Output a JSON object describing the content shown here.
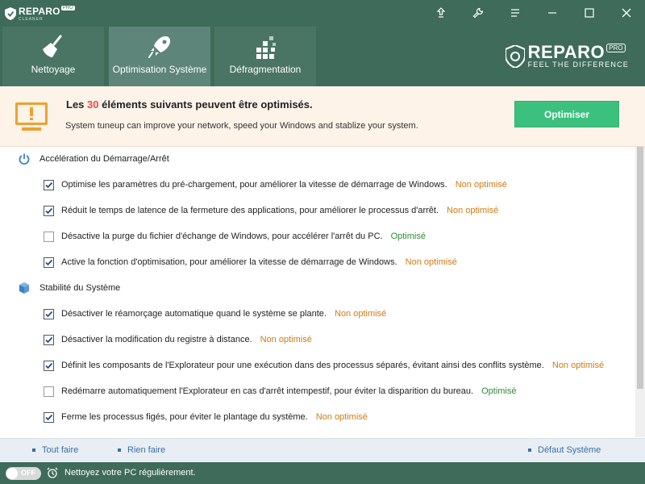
{
  "app": {
    "logo_name": "REPARO",
    "logo_sub": "CLEANER",
    "logo_badge": "PRO"
  },
  "window_controls": [
    "upload-icon",
    "wrench-icon",
    "menu-icon",
    "minimize-icon",
    "maximize-icon",
    "close-icon"
  ],
  "tabs": [
    {
      "label": "Nettoyage",
      "icon": "broom-icon",
      "active": false
    },
    {
      "label": "Optimisation Système",
      "icon": "rocket-icon",
      "active": true
    },
    {
      "label": "Défragmentation",
      "icon": "defrag-icon",
      "active": false
    }
  ],
  "brand": {
    "name": "REPARO",
    "badge": "PRO",
    "tagline": "FEEL THE DIFFERENCE"
  },
  "banner": {
    "title_pre": "Les ",
    "count": "30",
    "title_post": " éléments suivants peuvent être optimisés.",
    "subtitle": "System tuneup can improve your network, speed your Windows and stablize your system.",
    "button": "Optimiser",
    "accent": "#3bc07e"
  },
  "sections": [
    {
      "title": "Accélération du Démarrage/Arrêt",
      "icon": "power-icon",
      "items": [
        {
          "text": "Optimise les paramètres du pré-chargement, pour améliorer la vitesse de démarrage de Windows.",
          "checked": true,
          "status": "Non optimisé"
        },
        {
          "text": "Réduit le temps de latence de la fermeture des applications, pour améliorer le processus d'arrêt.",
          "checked": true,
          "status": "Non optimisé"
        },
        {
          "text": "Désactive la purge du fichier d'échange de Windows, pour accélérer l'arrêt du PC.",
          "checked": false,
          "status": "Optimisé"
        },
        {
          "text": "Active la fonction d'optimisation, pour améliorer la vitesse de démarrage de Windows.",
          "checked": true,
          "status": "Non optimisé"
        }
      ]
    },
    {
      "title": "Stabilité du Système",
      "icon": "cube-icon",
      "items": [
        {
          "text": "Désactiver le réamorçage automatique quand le système se plante.",
          "checked": true,
          "status": "Non optimisé"
        },
        {
          "text": "Désactiver la modification du registre à distance.",
          "checked": true,
          "status": "Non optimisé"
        },
        {
          "text": "Définit les composants de l'Explorateur pour une exécution dans des processus séparés, évitant ainsi des conflits système.",
          "checked": true,
          "status": "Non optimisé"
        },
        {
          "text": "Redémarre automatiquement l'Explorateur en cas d'arrêt intempestif, pour éviter la disparition du bureau.",
          "checked": false,
          "status": "Optimisé"
        },
        {
          "text": "Ferme les processus figés, pour éviter le plantage du système.",
          "checked": true,
          "status": "Non optimisé"
        }
      ]
    }
  ],
  "actions": {
    "select_all": "Tout faire",
    "select_none": "Rien faire",
    "default": "Défaut Système"
  },
  "statusbar": {
    "toggle_label": "OFF",
    "message": "Nettoyez votre PC régulièrement."
  },
  "colors": {
    "header": "#3e6b5a",
    "not_optimized": "#d07a13",
    "optimized": "#2e8a3a"
  }
}
